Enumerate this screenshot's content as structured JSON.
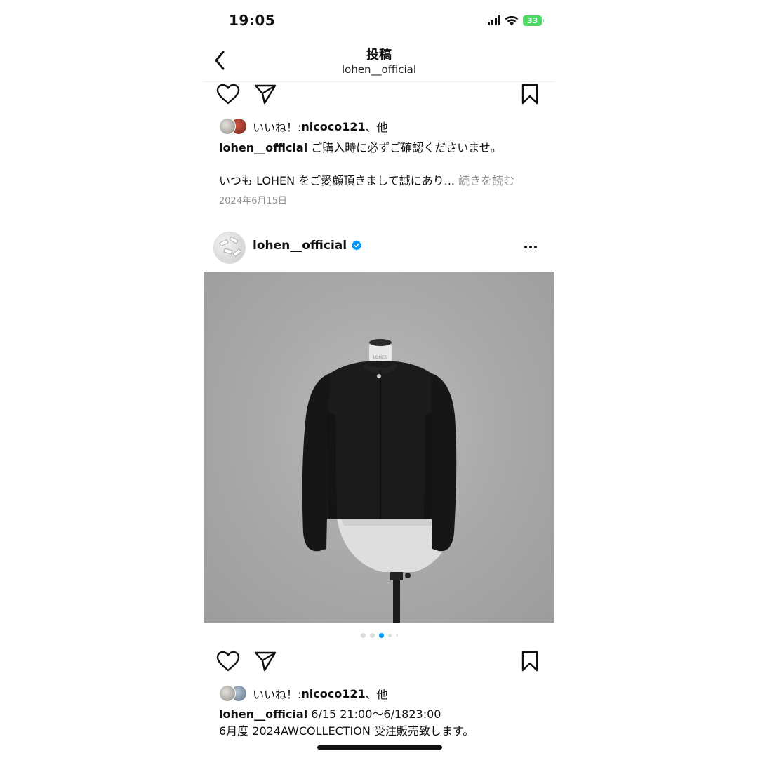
{
  "status_bar": {
    "time": "19:05",
    "battery": "33"
  },
  "header": {
    "title": "投稿",
    "subtitle": "lohen__official"
  },
  "post1": {
    "likes_prefix": "いいね！: ",
    "likes_user": "nicoco121",
    "likes_suffix": "、他",
    "caption_user": "lohen__official",
    "caption_text": " ご購入時に必ずご確認くださいませ。",
    "caption_line2": "いつも LOHEN をご愛顧頂きまして誠にあり...",
    "more_label": " 続きを読む",
    "date": "2024年6月15日"
  },
  "post2": {
    "username": "lohen__official",
    "image_alt": "LOHEN",
    "carousel_active_index": 2,
    "likes_prefix": "いいね！: ",
    "likes_user": "nicoco121",
    "likes_suffix": "、他",
    "caption_user": "lohen__official",
    "caption_text": " 6/15 21:00～6/1823:00",
    "caption_line2": "6月度 2024AWCOLLECTION 受注販売致します。"
  },
  "icons": {
    "back": "chevron-left-icon",
    "like": "heart-icon",
    "share": "paper-plane-icon",
    "save": "bookmark-icon",
    "verified": "verified-badge-icon",
    "more": "more-horizontal-icon"
  },
  "colors": {
    "accent": "#0095f6",
    "muted": "#8e8e8e",
    "battery": "#4cd964"
  }
}
